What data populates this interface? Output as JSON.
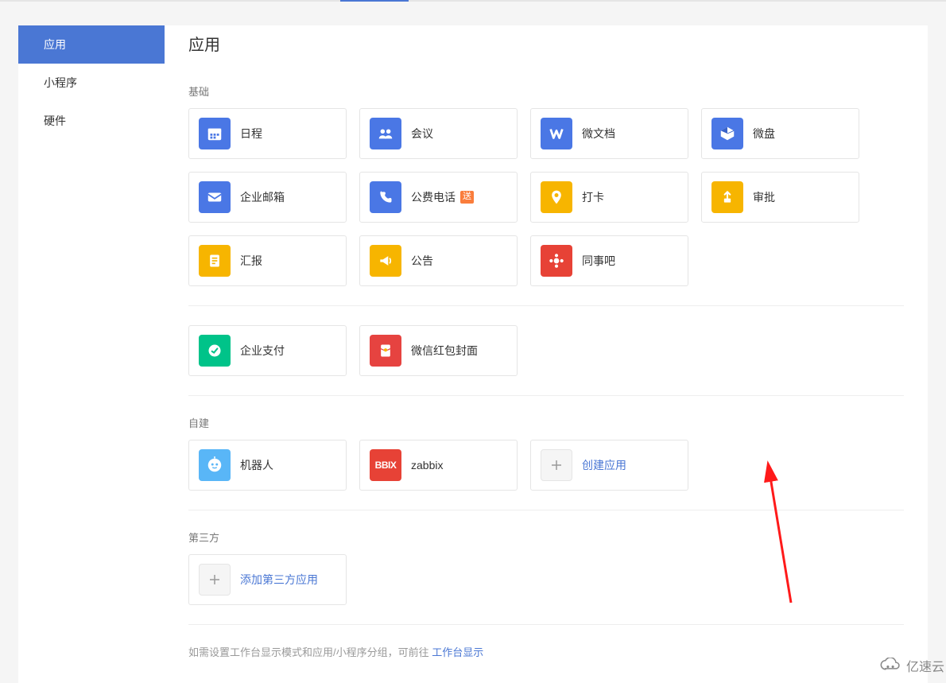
{
  "sidebar": {
    "items": [
      {
        "label": "应用",
        "active": true
      },
      {
        "label": "小程序",
        "active": false
      },
      {
        "label": "硬件",
        "active": false
      }
    ]
  },
  "page": {
    "title": "应用"
  },
  "sections": {
    "basic": {
      "title": "基础",
      "apps": {
        "calendar": "日程",
        "meeting": "会议",
        "doc": "微文档",
        "drive": "微盘",
        "mail": "企业邮箱",
        "phone": "公费电话",
        "phone_badge": "送",
        "checkin": "打卡",
        "approval": "审批",
        "report": "汇报",
        "announce": "公告",
        "colleague": "同事吧"
      }
    },
    "pay": {
      "apps": {
        "payment": "企业支付",
        "redpacket": "微信红包封面"
      }
    },
    "custom": {
      "title": "自建",
      "apps": {
        "robot": "机器人",
        "zabbix": "zabbix",
        "zabbix_icon_text": "BBIX",
        "create": "创建应用"
      }
    },
    "thirdparty": {
      "title": "第三方",
      "add": "添加第三方应用"
    }
  },
  "footer": {
    "note_prefix": "如需设置工作台显示模式和应用/小程序分组，可前往 ",
    "link": "工作台显示"
  },
  "watermark": "亿速云"
}
